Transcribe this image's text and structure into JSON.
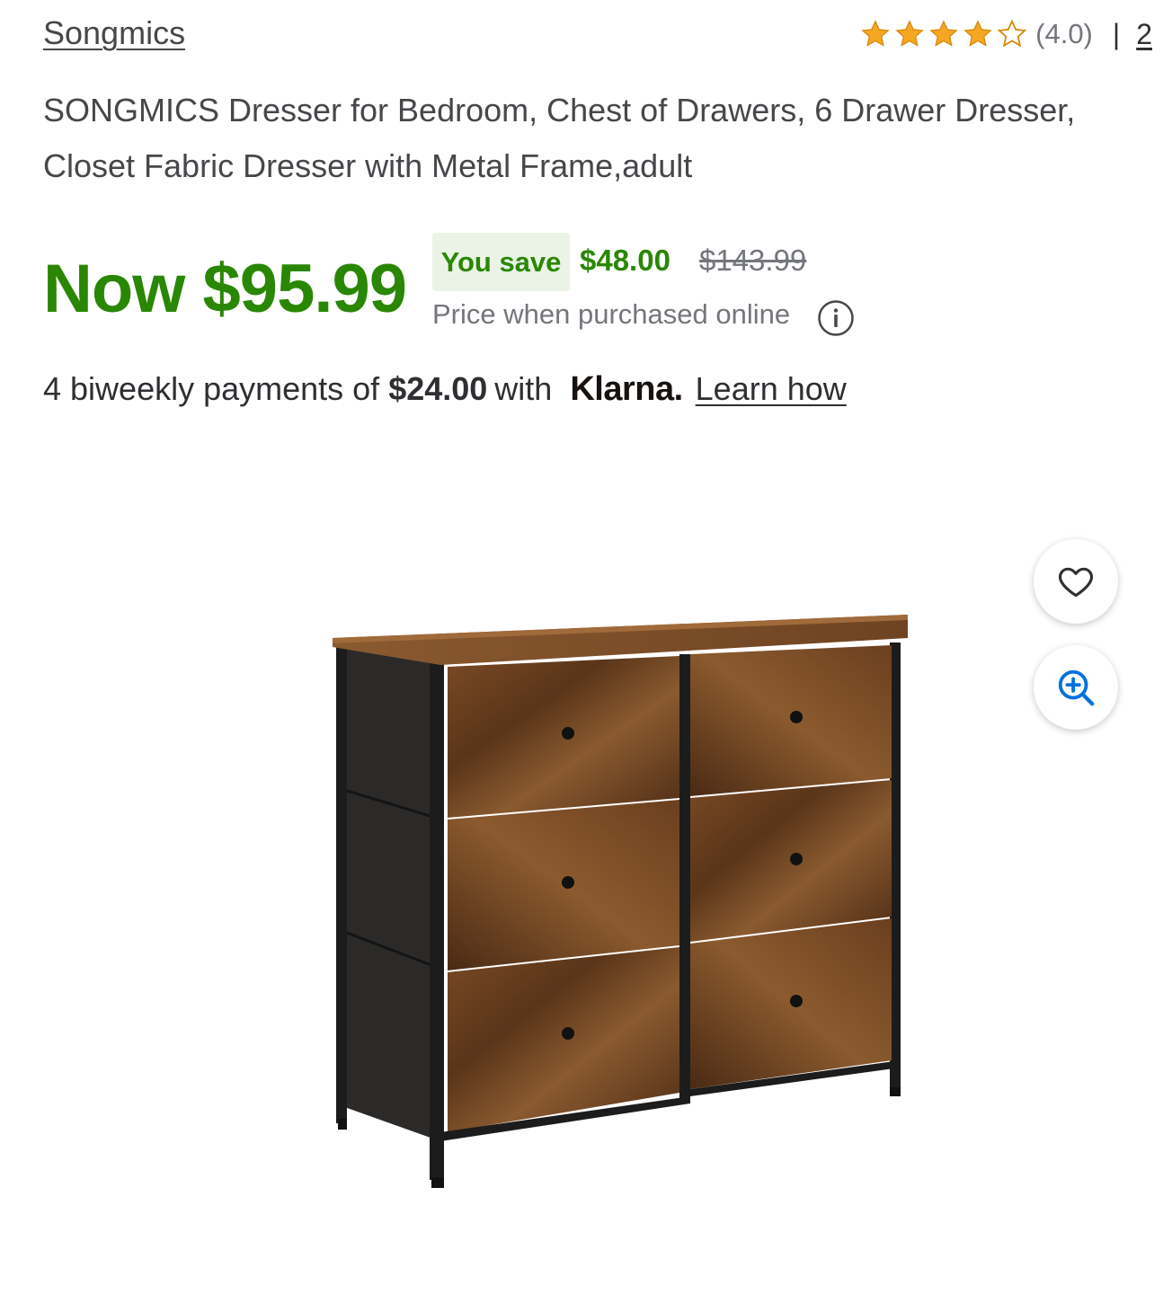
{
  "brand": "Songmics",
  "rating": {
    "value_text": "(4.0)",
    "stars_filled": 4,
    "stars_total": 5,
    "separator": "|",
    "review_count": "2"
  },
  "title": "SONGMICS Dresser for Bedroom, Chest of Drawers, 6 Drawer Dresser, Closet Fabric Dresser with Metal Frame,adult",
  "price": {
    "now": "Now $95.99",
    "you_save_label": "You save",
    "save_amount": "$48.00",
    "was": "$143.99",
    "note": "Price when purchased online"
  },
  "klarna": {
    "prefix": "4 biweekly payments of",
    "amount": "$24.00",
    "with": "with",
    "logo_text": "Klarna.",
    "learn_how": "Learn how"
  },
  "icons": {
    "star": "star-icon",
    "info": "info-icon",
    "favorite": "heart-icon",
    "zoom": "zoom-in-icon"
  },
  "colors": {
    "price_green": "#2a8703",
    "badge_bg": "#eaf3e6",
    "star_gold": "#f5a623",
    "zoom_blue": "#0071dc",
    "muted_text": "#74767c"
  }
}
